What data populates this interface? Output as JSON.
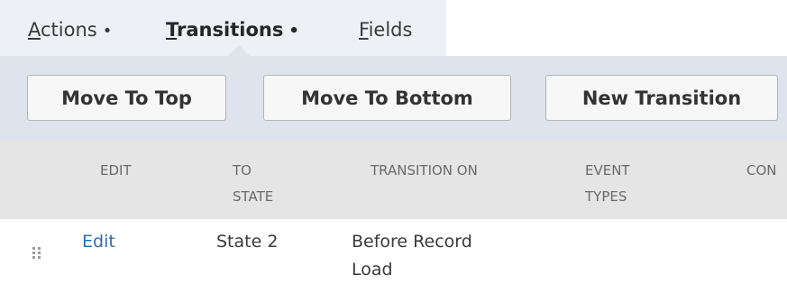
{
  "tabs": [
    {
      "label": "Actions",
      "mnemonic": "A",
      "rest": "ctions",
      "dot": "•",
      "active": false
    },
    {
      "label": "Transitions",
      "mnemonic": "T",
      "rest": "ransitions",
      "dot": "•",
      "active": true
    },
    {
      "label": "Fields",
      "mnemonic": "F",
      "rest": "ields",
      "dot": "",
      "active": false
    }
  ],
  "toolbar": {
    "move_to_top": "Move To Top",
    "move_to_bottom": "Move To Bottom",
    "new_transition": "New Transition"
  },
  "table": {
    "headers": {
      "edit": "EDIT",
      "to_state_1": "TO",
      "to_state_2": "STATE",
      "transition_on": "TRANSITION ON",
      "event_types_1": "EVENT",
      "event_types_2": "TYPES",
      "condition": "CON"
    },
    "rows": [
      {
        "edit": "Edit",
        "to_state": "State 2",
        "transition_on_1": "Before Record",
        "transition_on_2": "Load"
      }
    ]
  },
  "icons": {
    "drag_handle": "drag-handle-icon"
  }
}
